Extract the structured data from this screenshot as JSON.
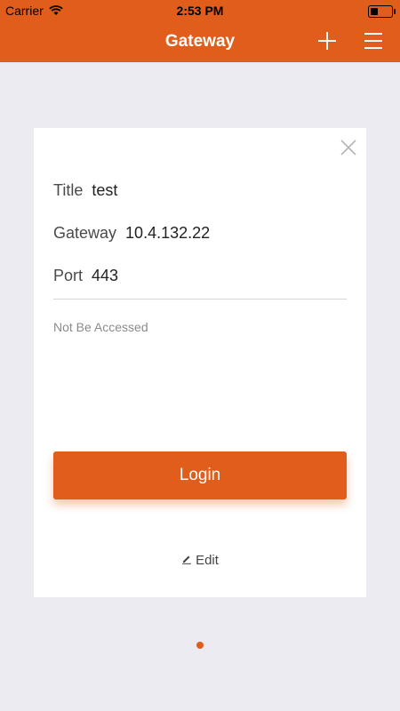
{
  "status_bar": {
    "carrier": "Carrier",
    "time": "2:53 PM",
    "battery_level": 0.35
  },
  "header": {
    "title": "Gateway",
    "add_icon": "plus-icon",
    "menu_icon": "hamburger-menu-icon"
  },
  "card": {
    "close_icon": "close-icon",
    "fields": {
      "title_label": "Title",
      "title_value": "test",
      "gateway_label": "Gateway",
      "gateway_value": "10.4.132.22",
      "port_label": "Port",
      "port_value": "443"
    },
    "status_text": "Not Be Accessed",
    "login_label": "Login",
    "edit_label": "Edit",
    "edit_icon": "pencil-icon"
  },
  "pager": {
    "pages": 1,
    "current": 1
  },
  "colors": {
    "accent": "#e05d1c",
    "background": "#ecebf1",
    "card": "#ffffff"
  }
}
